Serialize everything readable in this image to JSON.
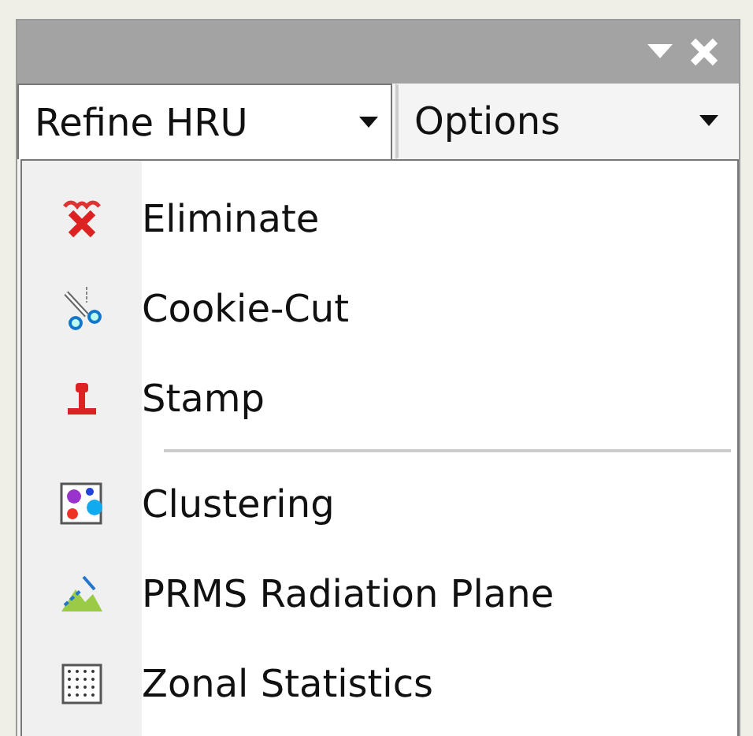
{
  "toolbar": {
    "buttons": [
      {
        "label": "Refine HRU",
        "selected": true
      },
      {
        "label": "Options",
        "selected": false
      }
    ]
  },
  "menu": {
    "groups": [
      {
        "items": [
          {
            "label": "Eliminate"
          },
          {
            "label": "Cookie-Cut"
          },
          {
            "label": "Stamp"
          }
        ]
      },
      {
        "items": [
          {
            "label": "Clustering"
          },
          {
            "label": "PRMS Radiation Plane"
          },
          {
            "label": "Zonal Statistics"
          }
        ]
      }
    ]
  }
}
